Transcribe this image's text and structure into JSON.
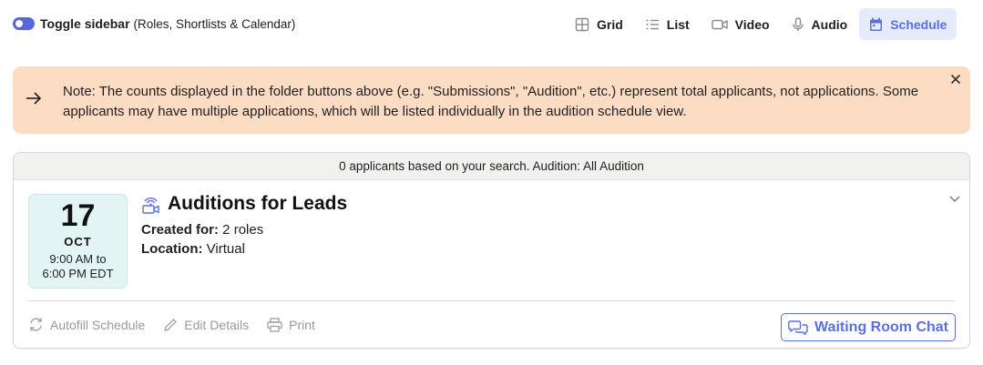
{
  "topbar": {
    "toggle_label": "Toggle sidebar",
    "toggle_sub": "(Roles, Shortlists & Calendar)",
    "views": [
      {
        "label": "Grid",
        "icon": "grid-icon"
      },
      {
        "label": "List",
        "icon": "list-icon"
      },
      {
        "label": "Video",
        "icon": "video-icon"
      },
      {
        "label": "Audio",
        "icon": "microphone-icon"
      },
      {
        "label": "Schedule",
        "icon": "calendar-icon"
      }
    ],
    "active_view": "Schedule"
  },
  "note": {
    "text": "Note: The counts displayed in the folder buttons above (e.g. \"Submissions\", \"Audition\", etc.) represent total applicants, not applications. Some applicants may have multiple applications, which will be listed individually in the audition schedule view."
  },
  "card": {
    "header": "0 applicants based on your search. Audition: All Audition",
    "date": {
      "day": "17",
      "month": "OCT",
      "time_start": "9:00 AM to",
      "time_end": "6:00 PM EDT"
    },
    "title": "Auditions for Leads",
    "created_for_label": "Created for:",
    "created_for_value": " 2 roles",
    "location_label": "Location:",
    "location_value": " Virtual",
    "actions": {
      "autofill": "Autofill Schedule",
      "edit": "Edit Details",
      "print": "Print"
    },
    "chat_button": "Waiting Room Chat"
  },
  "colors": {
    "accent": "#5a6fe0",
    "note_bg": "#fddcc4",
    "date_bg": "#e3f4f4",
    "active_tab_bg": "#e6ebfb"
  }
}
